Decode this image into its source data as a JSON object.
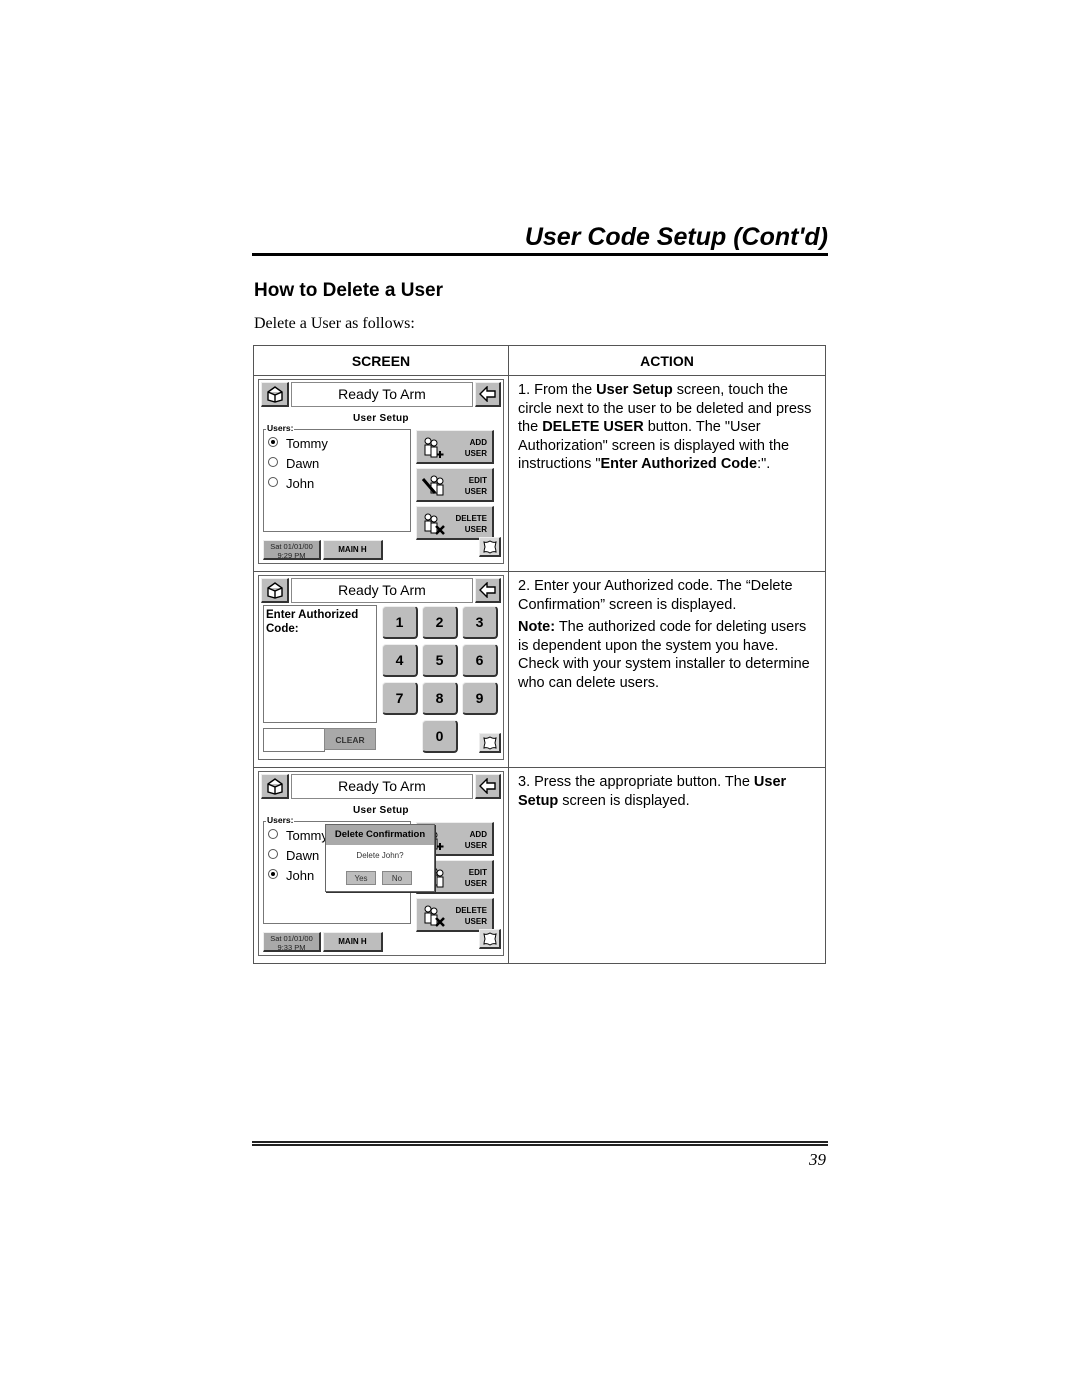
{
  "header": {
    "title": "User Code Setup (Cont'd)"
  },
  "section": {
    "heading": "How to Delete a User",
    "intro": "Delete a User as follows:"
  },
  "table": {
    "headers": {
      "screen": "SCREEN",
      "action": "ACTION"
    },
    "rows": [
      {
        "screen": {
          "status": "Ready To Arm",
          "subtitle": "User Setup",
          "users_label": "Users:",
          "users": [
            {
              "name": "Tommy",
              "selected": true
            },
            {
              "name": "Dawn",
              "selected": false
            },
            {
              "name": "John",
              "selected": false
            }
          ],
          "buttons": {
            "add": {
              "line1": "ADD",
              "line2": "USER"
            },
            "edit": {
              "line1": "EDIT",
              "line2": "USER"
            },
            "delete": {
              "line1": "DELETE",
              "line2": "USER"
            }
          },
          "date": "Sat 01/01/00",
          "time": "9:29 PM",
          "main_label": "MAIN H"
        },
        "action": {
          "p1": "1.  From the ",
          "b1": "User Setup",
          "p2": " screen, touch the circle next to the user to be deleted and press the ",
          "b2": "DELETE USER",
          "p3": " button. The \"User Authorization\" screen is displayed with the instructions \"",
          "b3": "Enter Authorized Code",
          "p4": ":\"."
        }
      },
      {
        "screen": {
          "status": "Ready To Arm",
          "prompt_line1": "Enter Authorized",
          "prompt_line2": "Code:",
          "keys": [
            "1",
            "2",
            "3",
            "4",
            "5",
            "6",
            "7",
            "8",
            "9",
            "0"
          ],
          "code_value": "",
          "clear_label": "CLEAR"
        },
        "action": {
          "p1": "2.  Enter your Authorized code.  The “Delete Confirmation” screen is displayed.",
          "note_label": "Note:",
          "note_text": " The authorized code for deleting users is dependent upon the system you have. Check with your system installer to determine who can delete users."
        }
      },
      {
        "screen": {
          "status": "Ready To Arm",
          "subtitle": "User Setup",
          "users_label": "Users:",
          "users": [
            {
              "name": "Tommy",
              "selected": false
            },
            {
              "name": "Dawn",
              "selected": false
            },
            {
              "name": "John",
              "selected": true
            }
          ],
          "buttons": {
            "add": {
              "line1": "ADD",
              "line2": "USER"
            },
            "edit": {
              "line1": "EDIT",
              "line2": "USER"
            },
            "delete": {
              "line1": "DELETE",
              "line2": "USER"
            }
          },
          "dialog": {
            "title": "Delete Confirmation",
            "message": "Delete John?",
            "yes": "Yes",
            "no": "No"
          },
          "date": "Sat 01/01/00",
          "time": "9:33 PM",
          "main_label": "MAIN H"
        },
        "action": {
          "p1": "3.  Press the appropriate button.  The ",
          "b1": "User Setup",
          "p2": " screen is displayed."
        }
      }
    ]
  },
  "footer": {
    "page_number": "39"
  },
  "icons": {
    "home": "home-icon",
    "back": "back-arrow-icon",
    "shield": "shield-icon",
    "add_user": "add-user-icon",
    "edit_user": "edit-user-icon",
    "delete_user": "delete-user-icon"
  }
}
